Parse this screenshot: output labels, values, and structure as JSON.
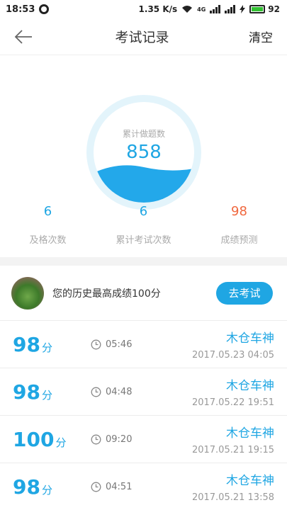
{
  "status_bar": {
    "time": "18:53",
    "net_speed": "1.35 K/s",
    "battery": "92",
    "network": "4G"
  },
  "header": {
    "title": "考试记录",
    "action": "清空"
  },
  "stats": {
    "gauge_label": "累计做题数",
    "gauge_value": "858",
    "items": [
      {
        "value": "6",
        "label": "及格次数"
      },
      {
        "value": "6",
        "label": "累计考试次数"
      },
      {
        "value": "98",
        "label": "成绩预测"
      }
    ]
  },
  "best": {
    "text": "您的历史最高成绩100分",
    "button": "去考试"
  },
  "records": [
    {
      "score": "98",
      "unit": "分",
      "duration": "05:46",
      "user": "木仓车神",
      "date": "2017.05.23  04:05"
    },
    {
      "score": "98",
      "unit": "分",
      "duration": "04:48",
      "user": "木仓车神",
      "date": "2017.05.22  19:51"
    },
    {
      "score": "100",
      "unit": "分",
      "duration": "09:20",
      "user": "木仓车神",
      "date": "2017.05.21  19:15"
    },
    {
      "score": "98",
      "unit": "分",
      "duration": "04:51",
      "user": "木仓车神",
      "date": "2017.05.21  13:58"
    }
  ],
  "colors": {
    "accent": "#1fa6e3",
    "predict": "#f0683f"
  }
}
